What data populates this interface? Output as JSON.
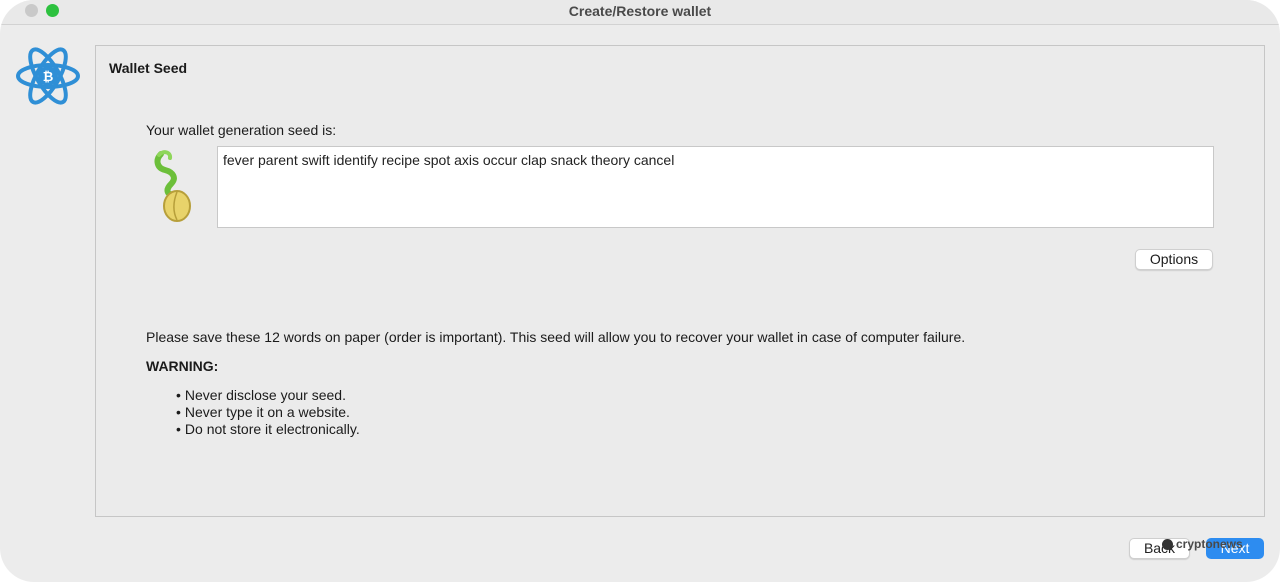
{
  "window": {
    "title": "Create/Restore wallet"
  },
  "panel": {
    "title": "Wallet Seed",
    "seed_label": "Your wallet generation seed is:",
    "seed_text": "fever parent swift identify recipe spot axis occur clap snack theory cancel",
    "options_label": "Options",
    "instructions": "Please save these 12 words on paper (order is important). This seed will allow you to recover your wallet in case of computer failure.",
    "warning_title": "WARNING:",
    "warnings": [
      "Never disclose your seed.",
      "Never type it on a website.",
      "Do not store it electronically."
    ]
  },
  "footer": {
    "back_label": "Back",
    "next_label": "Next"
  },
  "watermark": {
    "text": "cryptonews"
  },
  "icons": {
    "logo": "electrum-atom-bitcoin-icon",
    "seed": "sprouting-seed-icon"
  },
  "colors": {
    "accent": "#2d8cf0",
    "logo": "#2f8fd6",
    "traffic_green": "#2dc13f"
  }
}
